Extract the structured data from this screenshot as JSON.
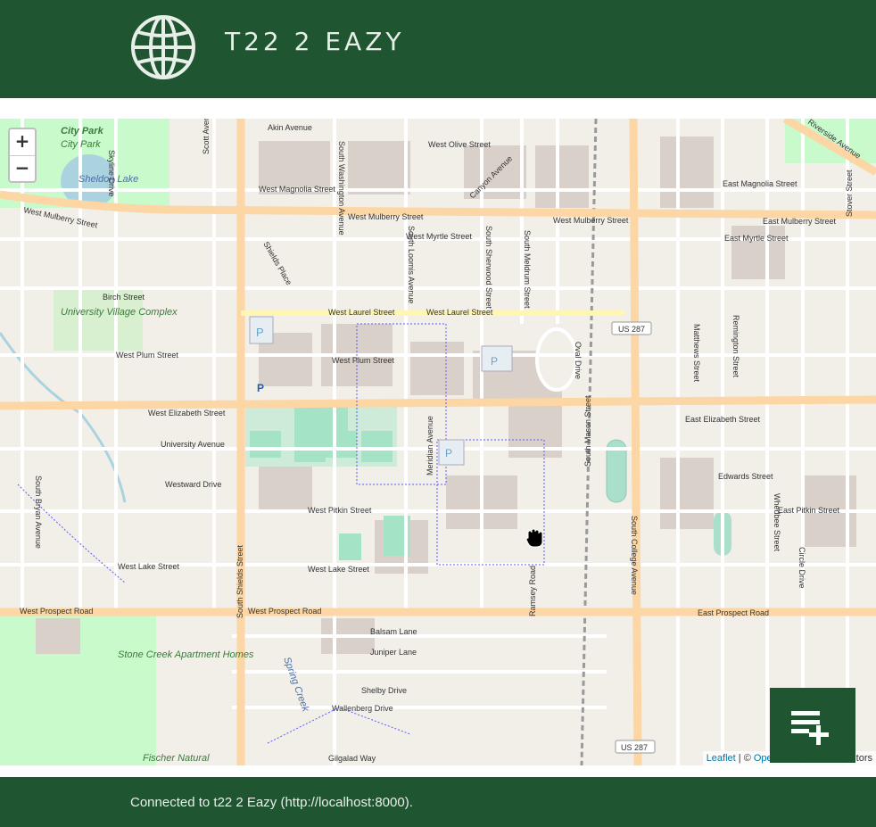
{
  "app": {
    "title": "T22 2 EAZY"
  },
  "map": {
    "zoom_in_label": "+",
    "zoom_out_label": "−",
    "attribution": {
      "leaflet": "Leaflet",
      "separator": " | © ",
      "osm": "Ope",
      "tail": "tors"
    },
    "shields": [
      "US 287",
      "US 287"
    ],
    "places": {
      "city_park_1": "City Park",
      "city_park_2": "City Park",
      "sheldon_lake": "Sheldon Lake",
      "university_village": "University Village Complex",
      "stone_creek": "Stone Creek Apartment Homes",
      "fischer": "Fischer Natural"
    },
    "streets": {
      "w_mulberry": "West Mulberry Street",
      "e_mulberry": "East Mulberry Street",
      "w_laurel_1": "West Laurel Street",
      "w_laurel_2": "West Laurel Street",
      "w_elizabeth": "West Elizabeth Street",
      "e_elizabeth": "East Elizabeth Street",
      "w_prospect": "West Prospect Road",
      "w_prospect_2": "West Prospect Road",
      "e_prospect": "East Prospect Road",
      "w_plum": "West Plum Street",
      "w_plum_2": "West Plum Street",
      "w_pitkin": "West Pitkin Street",
      "e_pitkin": "East Pitkin Street",
      "w_lake": "West Lake Street",
      "w_lake_2": "West Lake Street",
      "s_shields": "South Shields Street",
      "s_college": "South College Avenue",
      "s_mason": "South Mason Street",
      "w_myrtle": "West Myrtle Street",
      "e_myrtle": "East Myrtle Street",
      "e_magnolia": "East Magnolia Street",
      "w_magnolia": "West Magnolia Street",
      "w_olive": "West Olive Street",
      "akin": "Akin Avenue",
      "birch": "Birch Street",
      "university_ave": "University Avenue",
      "westward": "Westward Drive",
      "balsam": "Balsam Lane",
      "juniper": "Juniper Lane",
      "shelby": "Shelby Drive",
      "wallenberg": "Wallenberg Drive",
      "gilgalad": "Gilgalad Way",
      "edwards": "Edwards Street",
      "matthews": "Matthews Street",
      "stover": "Stover Street",
      "whedbee": "Whedbee Street",
      "circle": "Circle Drive",
      "remington": "Remington Street",
      "meldrum": "South Meldrum Street",
      "sherwood": "South Sherwood Street",
      "loomis": "South Loomis Avenue",
      "washington": "South Washington Avenue",
      "meridian": "Meridian Avenue",
      "oval": "Oval Drive",
      "ramsey": "Ramsey Road",
      "scott": "Scott Avenue",
      "skyline": "Skyline Drive",
      "spring_creek": "Spring Creek",
      "bryan": "South Bryan Avenue",
      "canyon": "Canyon Avenue",
      "riverside": "Riverside Avenue",
      "shields_pl": "Shields Place"
    }
  },
  "footer": {
    "status": " Connected to t22 2 Eazy  (http://localhost:8000)."
  },
  "colors": {
    "brand": "#1f5631",
    "road_major": "#fcd6a4",
    "park": "#c8facc",
    "water": "#aad3df",
    "building": "#d9d0c9"
  },
  "icons": [
    "globe-icon",
    "playlist-add-icon",
    "hand-cursor-icon",
    "parking-icon"
  ]
}
